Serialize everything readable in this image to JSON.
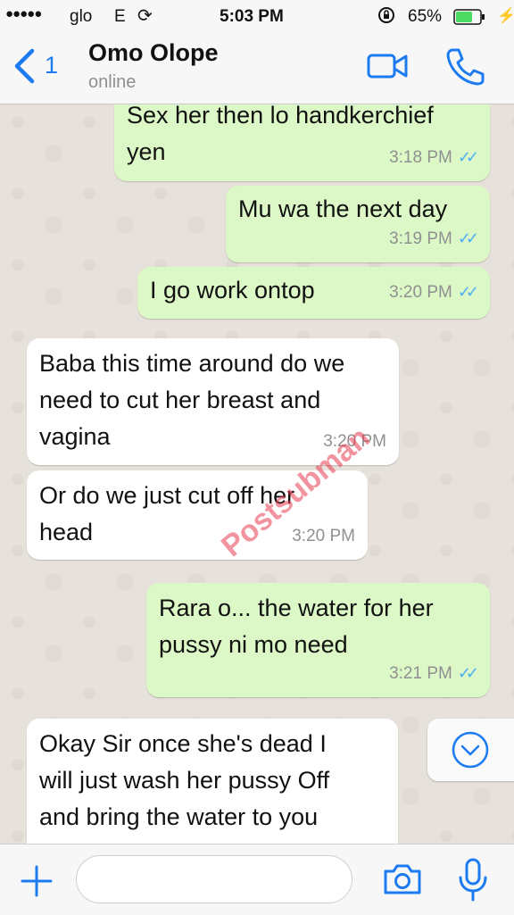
{
  "status_bar": {
    "signal": "●●●●●",
    "carrier": "glo",
    "network": "E",
    "time": "5:03 PM",
    "battery": "65%"
  },
  "header": {
    "back_count": "1",
    "contact_name": "Omo Olope",
    "contact_status": "online"
  },
  "messages": [
    {
      "direction": "out",
      "lines": [
        "Sex her then lo handkerchief",
        "yen"
      ],
      "time": "3:18 PM",
      "read": true
    },
    {
      "direction": "out",
      "lines": [
        "Mu wa the next day"
      ],
      "time": "3:19 PM",
      "read": true
    },
    {
      "direction": "out",
      "lines": [
        "I go work ontop"
      ],
      "time": "3:20 PM",
      "read": true
    },
    {
      "direction": "in",
      "lines": [
        "Baba this time around do we",
        "need to cut her breast and",
        "vagina"
      ],
      "time": "3:20 PM"
    },
    {
      "direction": "in",
      "lines": [
        "Or do we just cut off her",
        "head"
      ],
      "time": "3:20 PM"
    },
    {
      "direction": "out",
      "lines": [
        "Rara o... the water for her",
        "pussy ni mo need"
      ],
      "time": "3:21 PM",
      "read": true
    },
    {
      "direction": "in",
      "lines": [
        "Okay Sir once she's dead I",
        "will just wash her pussy Off",
        "and bring the water to you"
      ],
      "time": ""
    }
  ],
  "watermark": "Postsubman",
  "colors": {
    "accent": "#1d7bf2",
    "outgoing_bubble": "#dcf8c6",
    "incoming_bubble": "#ffffff",
    "read_ticks": "#4fb0f2",
    "battery": "#4cd964"
  },
  "icons": [
    "back-chevron-icon",
    "video-call-icon",
    "phone-icon",
    "scroll-down-icon",
    "plus-icon",
    "camera-icon",
    "microphone-icon",
    "sync-icon",
    "lock-rotation-icon",
    "battery-icon",
    "charging-icon"
  ]
}
